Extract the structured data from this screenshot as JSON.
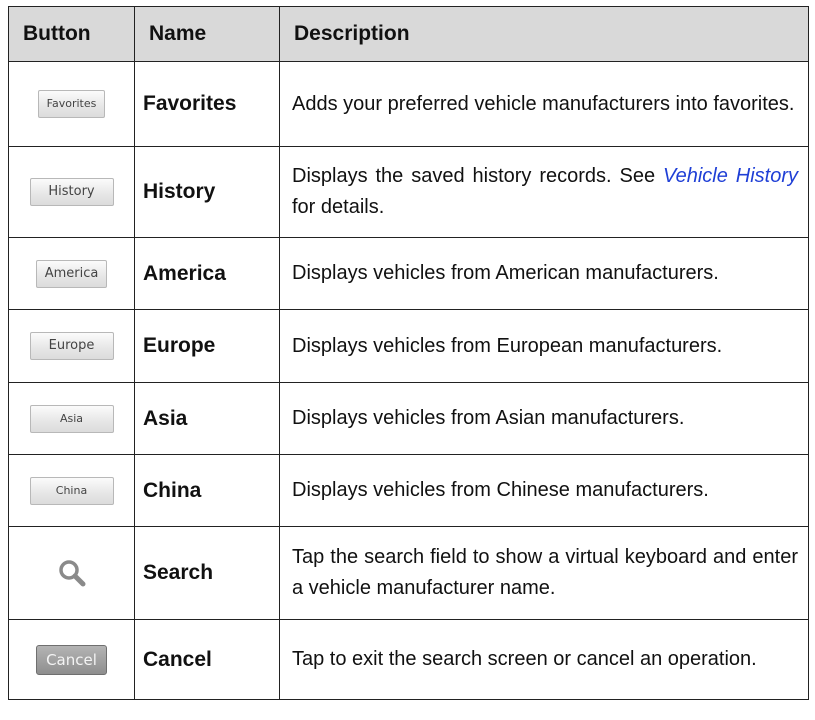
{
  "table": {
    "headers": {
      "button": "Button",
      "name": "Name",
      "description": "Description"
    },
    "rows": [
      {
        "button_label": "Favorites",
        "name": "Favorites",
        "description": "Adds your preferred vehicle manufacturers into favorites."
      },
      {
        "button_label": "History",
        "name": "History",
        "description_pre": "Displays the saved history records. See ",
        "description_link": "Vehicle History",
        "description_post": " for details."
      },
      {
        "button_label": "America",
        "name": "America",
        "description": "Displays vehicles from American manufacturers."
      },
      {
        "button_label": "Europe",
        "name": "Europe",
        "description": "Displays vehicles from European manufacturers."
      },
      {
        "button_label": "Asia",
        "name": "Asia",
        "description": "Displays vehicles from Asian manufacturers."
      },
      {
        "button_label": "China",
        "name": "China",
        "description": "Displays vehicles from Chinese manufacturers."
      },
      {
        "button_icon": "search-icon",
        "name": "Search",
        "description": "Tap the search field to show a virtual keyboard and enter a vehicle manufacturer name."
      },
      {
        "button_label": "Cancel",
        "name": "Cancel",
        "description": "Tap to exit the search screen or cancel an operation."
      }
    ]
  },
  "colors": {
    "link": "#1f3fd6",
    "header_bg": "#d9d9d9",
    "cancel_button": "#9a9a9a"
  }
}
